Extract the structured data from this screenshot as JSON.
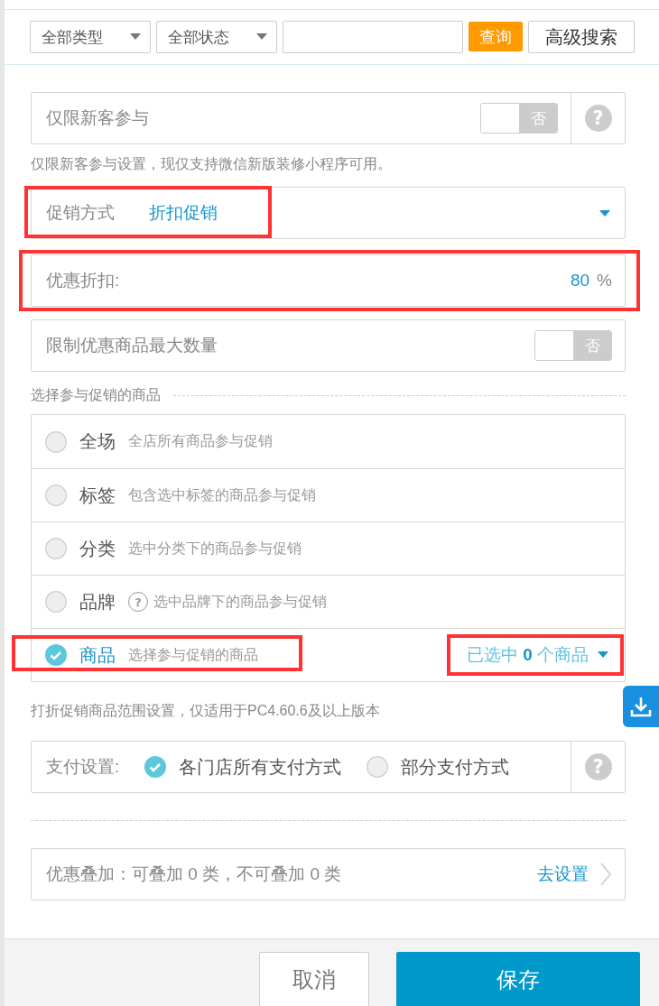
{
  "toolbar": {
    "filters": [
      {
        "label": "全部类型"
      },
      {
        "label": "全部状态"
      }
    ],
    "query_button": "查询",
    "advanced_button": "高级搜索"
  },
  "new_customer": {
    "label": "仅限新客参与",
    "toggle": {
      "label": "否",
      "on": false
    },
    "help": "?",
    "note": "仅限新客参与设置，现仅支持微信新版装修小程序可用。"
  },
  "promo_type": {
    "label": "促销方式",
    "value": "折扣促销",
    "highlighted": true
  },
  "discount": {
    "label": "优惠折扣:",
    "value": "80",
    "unit": "%",
    "highlighted": true
  },
  "max_limit": {
    "label": "限制优惠商品最大数量",
    "toggle": {
      "label": "否",
      "on": false
    }
  },
  "scope": {
    "title": "选择参与促销的商品",
    "options": [
      {
        "label": "全场",
        "desc": "全店所有商品参与促销",
        "selected": false
      },
      {
        "label": "标签",
        "desc": "包含选中标签的商品参与促销",
        "selected": false
      },
      {
        "label": "分类",
        "desc": "选中分类下的商品参与促销",
        "selected": false
      },
      {
        "label": "品牌",
        "desc": "选中品牌下的商品参与促销",
        "selected": false,
        "help": "?"
      },
      {
        "label": "商品",
        "desc": "选择参与促销的商品",
        "selected": true,
        "highlighted": true,
        "picker": {
          "text": "已选中 **0** 个商品",
          "highlighted": true
        }
      }
    ],
    "note": "打折促销商品范围设置，仅适用于PC4.60.6及以上版本"
  },
  "payment": {
    "label": "支付设置:",
    "help": "?",
    "options": [
      {
        "label": "各门店所有支付方式",
        "selected": true
      },
      {
        "label": "部分支付方式",
        "selected": false
      }
    ]
  },
  "stacking": {
    "text": "优惠叠加：可叠加 0 类，不可叠加 0 类",
    "link": "去设置"
  },
  "footer": {
    "cancel": "取消",
    "save": "保存"
  }
}
